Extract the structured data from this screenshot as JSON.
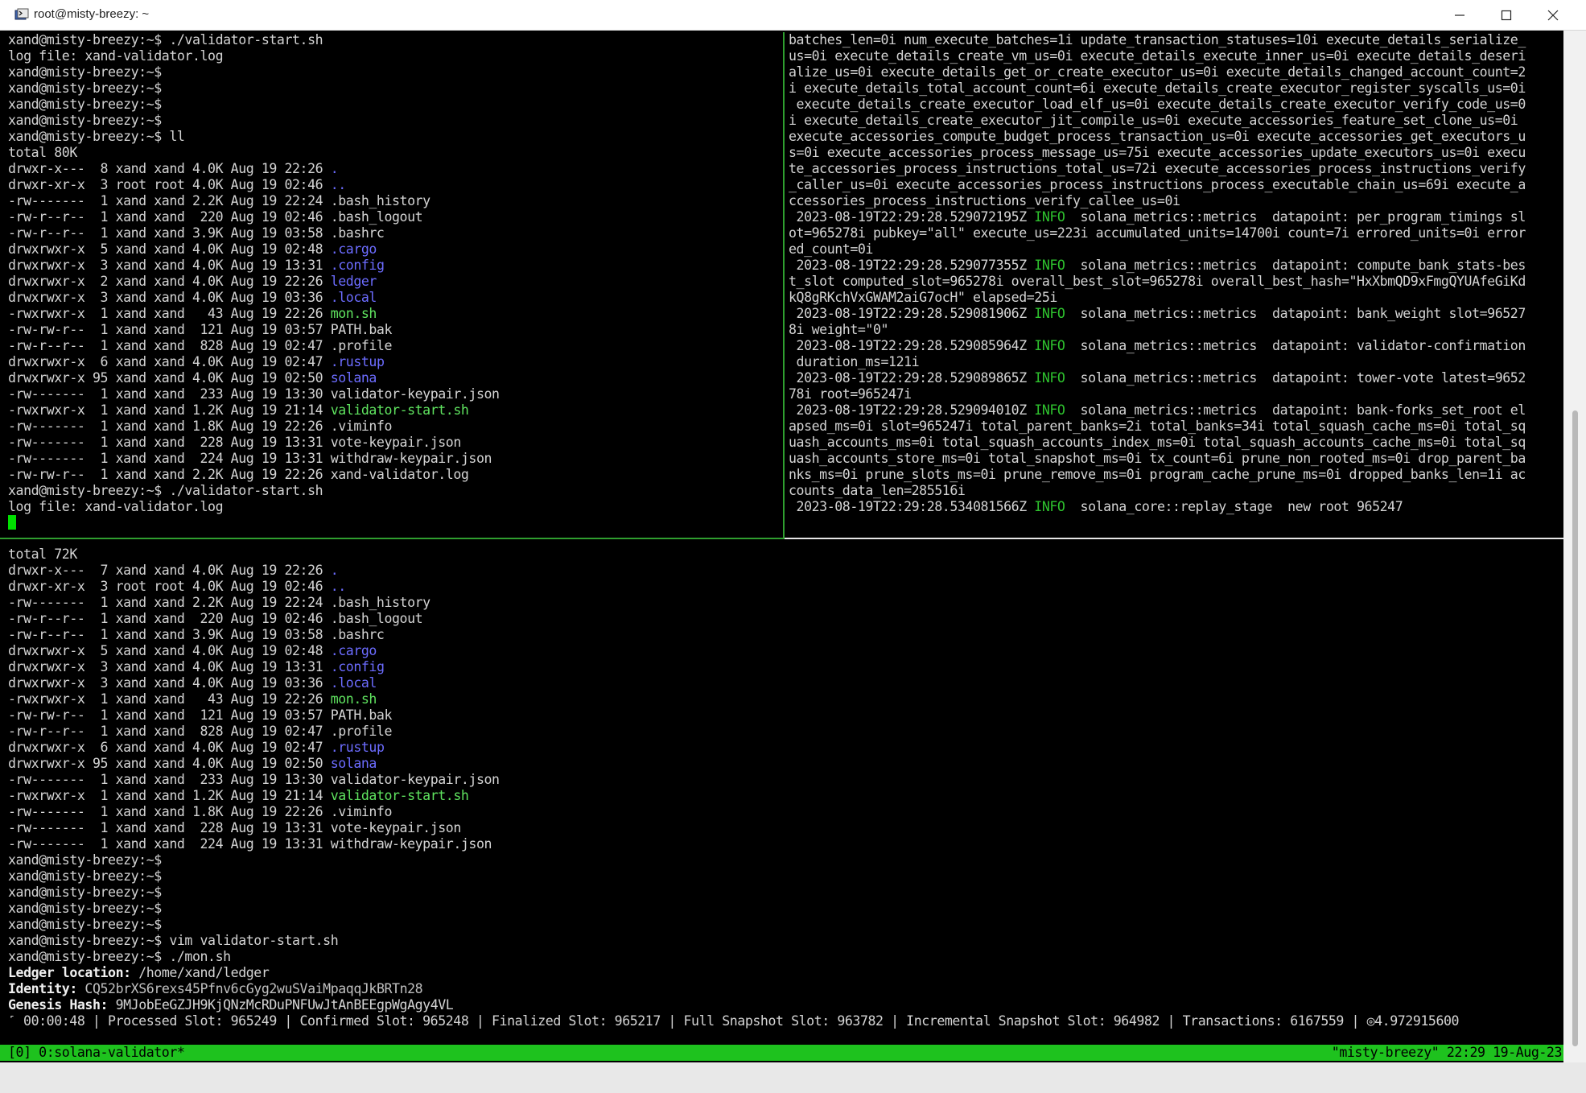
{
  "window": {
    "title": "root@misty-breezy: ~",
    "minimize_label": "–",
    "maximize_label": "□",
    "close_label": "×",
    "icon": "terminal-app-icon"
  },
  "pane_top_left": {
    "lines": [
      [
        {
          "t": "xand@misty-breezy:~$ ./validator-start.sh"
        }
      ],
      [
        {
          "t": "log file: xand-validator.log"
        }
      ],
      [
        {
          "t": "xand@misty-breezy:~$"
        }
      ],
      [
        {
          "t": "xand@misty-breezy:~$"
        }
      ],
      [
        {
          "t": "xand@misty-breezy:~$"
        }
      ],
      [
        {
          "t": "xand@misty-breezy:~$"
        }
      ],
      [
        {
          "t": "xand@misty-breezy:~$ ll"
        }
      ],
      [
        {
          "t": "total 80K"
        }
      ],
      [
        {
          "t": "drwxr-x---  8 xand xand 4.0K Aug 19 22:26 "
        },
        {
          "t": ".",
          "c": "blue"
        }
      ],
      [
        {
          "t": "drwxr-xr-x  3 root root 4.0K Aug 19 02:46 "
        },
        {
          "t": "..",
          "c": "blue"
        }
      ],
      [
        {
          "t": "-rw-------  1 xand xand 2.2K Aug 19 22:24 .bash_history"
        }
      ],
      [
        {
          "t": "-rw-r--r--  1 xand xand  220 Aug 19 02:46 .bash_logout"
        }
      ],
      [
        {
          "t": "-rw-r--r--  1 xand xand 3.9K Aug 19 03:58 .bashrc"
        }
      ],
      [
        {
          "t": "drwxrwxr-x  5 xand xand 4.0K Aug 19 02:48 "
        },
        {
          "t": ".cargo",
          "c": "blue"
        }
      ],
      [
        {
          "t": "drwxrwxr-x  3 xand xand 4.0K Aug 19 13:31 "
        },
        {
          "t": ".config",
          "c": "blue"
        }
      ],
      [
        {
          "t": "drwxrwxr-x  2 xand xand 4.0K Aug 19 22:26 "
        },
        {
          "t": "ledger",
          "c": "blue"
        }
      ],
      [
        {
          "t": "drwxrwxr-x  3 xand xand 4.0K Aug 19 03:36 "
        },
        {
          "t": ".local",
          "c": "blue"
        }
      ],
      [
        {
          "t": "-rwxrwxr-x  1 xand xand   43 Aug 19 22:26 "
        },
        {
          "t": "mon.sh",
          "c": "green"
        }
      ],
      [
        {
          "t": "-rw-rw-r--  1 xand xand  121 Aug 19 03:57 PATH.bak"
        }
      ],
      [
        {
          "t": "-rw-r--r--  1 xand xand  828 Aug 19 02:47 .profile"
        }
      ],
      [
        {
          "t": "drwxrwxr-x  6 xand xand 4.0K Aug 19 02:47 "
        },
        {
          "t": ".rustup",
          "c": "blue"
        }
      ],
      [
        {
          "t": "drwxrwxr-x 95 xand xand 4.0K Aug 19 02:50 "
        },
        {
          "t": "solana",
          "c": "blue"
        }
      ],
      [
        {
          "t": "-rw-------  1 xand xand  233 Aug 19 13:30 validator-keypair.json"
        }
      ],
      [
        {
          "t": "-rwxrwxr-x  1 xand xand 1.2K Aug 19 21:14 "
        },
        {
          "t": "validator-start.sh",
          "c": "green"
        }
      ],
      [
        {
          "t": "-rw-------  1 xand xand 1.8K Aug 19 22:26 .viminfo"
        }
      ],
      [
        {
          "t": "-rw-------  1 xand xand  228 Aug 19 13:31 vote-keypair.json"
        }
      ],
      [
        {
          "t": "-rw-------  1 xand xand  224 Aug 19 13:31 withdraw-keypair.json"
        }
      ],
      [
        {
          "t": "-rw-rw-r--  1 xand xand 2.2K Aug 19 22:26 xand-validator.log"
        }
      ],
      [
        {
          "t": "xand@misty-breezy:~$ ./validator-start.sh"
        }
      ],
      [
        {
          "t": "log file: xand-validator.log"
        }
      ]
    ]
  },
  "pane_top_right": {
    "lines": [
      [
        {
          "t": "batches_len=0i num_execute_batches=1i update_transaction_statuses=10i execute_details_serialize_"
        }
      ],
      [
        {
          "t": "us=0i execute_details_create_vm_us=0i execute_details_execute_inner_us=0i execute_details_deseri"
        }
      ],
      [
        {
          "t": "alize_us=0i execute_details_get_or_create_executor_us=0i execute_details_changed_account_count=2"
        }
      ],
      [
        {
          "t": "i execute_details_total_account_count=6i execute_details_create_executor_register_syscalls_us=0i"
        }
      ],
      [
        {
          "t": " execute_details_create_executor_load_elf_us=0i execute_details_create_executor_verify_code_us=0"
        }
      ],
      [
        {
          "t": "i execute_details_create_executor_jit_compile_us=0i execute_accessories_feature_set_clone_us=0i"
        }
      ],
      [
        {
          "t": "execute_accessories_compute_budget_process_transaction_us=0i execute_accessories_get_executors_u"
        }
      ],
      [
        {
          "t": "s=0i execute_accessories_process_message_us=75i execute_accessories_update_executors_us=0i execu"
        }
      ],
      [
        {
          "t": "te_accessories_process_instructions_total_us=72i execute_accessories_process_instructions_verify"
        }
      ],
      [
        {
          "t": "_caller_us=0i execute_accessories_process_instructions_process_executable_chain_us=69i execute_a"
        }
      ],
      [
        {
          "t": "ccessories_process_instructions_verify_callee_us=0i"
        }
      ],
      [
        {
          "t": " 2023-08-19T22:29:28.529072195Z "
        },
        {
          "t": "INFO",
          "c": "info"
        },
        {
          "t": "  solana_metrics::metrics  datapoint: per_program_timings sl"
        }
      ],
      [
        {
          "t": "ot=965278i pubkey=\"all\" execute_us=223i accumulated_units=14700i count=7i errored_units=0i error"
        }
      ],
      [
        {
          "t": "ed_count=0i"
        }
      ],
      [
        {
          "t": " 2023-08-19T22:29:28.529077355Z "
        },
        {
          "t": "INFO",
          "c": "info"
        },
        {
          "t": "  solana_metrics::metrics  datapoint: compute_bank_stats-bes"
        }
      ],
      [
        {
          "t": "t_slot computed_slot=965278i overall_best_slot=965278i overall_best_hash=\"HxXbmQD9xFmgQYUAfeGiKd"
        }
      ],
      [
        {
          "t": "kQ8gRKchVxGWAM2aiG7ocH\" elapsed=25i"
        }
      ],
      [
        {
          "t": " 2023-08-19T22:29:28.529081906Z "
        },
        {
          "t": "INFO",
          "c": "info"
        },
        {
          "t": "  solana_metrics::metrics  datapoint: bank_weight slot=96527"
        }
      ],
      [
        {
          "t": "8i weight=\"0\""
        }
      ],
      [
        {
          "t": " 2023-08-19T22:29:28.529085964Z "
        },
        {
          "t": "INFO",
          "c": "info"
        },
        {
          "t": "  solana_metrics::metrics  datapoint: validator-confirmation"
        }
      ],
      [
        {
          "t": " duration_ms=121i"
        }
      ],
      [
        {
          "t": " 2023-08-19T22:29:28.529089865Z "
        },
        {
          "t": "INFO",
          "c": "info"
        },
        {
          "t": "  solana_metrics::metrics  datapoint: tower-vote latest=9652"
        }
      ],
      [
        {
          "t": "78i root=965247i"
        }
      ],
      [
        {
          "t": " 2023-08-19T22:29:28.529094010Z "
        },
        {
          "t": "INFO",
          "c": "info"
        },
        {
          "t": "  solana_metrics::metrics  datapoint: bank-forks_set_root el"
        }
      ],
      [
        {
          "t": "apsed_ms=0i slot=965247i total_parent_banks=2i total_banks=34i total_squash_cache_ms=0i total_sq"
        }
      ],
      [
        {
          "t": "uash_accounts_ms=0i total_squash_accounts_index_ms=0i total_squash_accounts_cache_ms=0i total_sq"
        }
      ],
      [
        {
          "t": "uash_accounts_store_ms=0i total_snapshot_ms=0i tx_count=6i prune_non_rooted_ms=0i drop_parent_ba"
        }
      ],
      [
        {
          "t": "nks_ms=0i prune_slots_ms=0i prune_remove_ms=0i program_cache_prune_ms=0i dropped_banks_len=1i ac"
        }
      ],
      [
        {
          "t": "counts_data_len=285516i"
        }
      ],
      [
        {
          "t": " 2023-08-19T22:29:28.534081566Z "
        },
        {
          "t": "INFO",
          "c": "info"
        },
        {
          "t": "  solana_core::replay_stage  new root 965247"
        }
      ]
    ]
  },
  "pane_bottom": {
    "lines": [
      [
        {
          "t": "total 72K"
        }
      ],
      [
        {
          "t": "drwxr-x---  7 xand xand 4.0K Aug 19 22:26 "
        },
        {
          "t": ".",
          "c": "blue"
        }
      ],
      [
        {
          "t": "drwxr-xr-x  3 root root 4.0K Aug 19 02:46 "
        },
        {
          "t": "..",
          "c": "blue"
        }
      ],
      [
        {
          "t": "-rw-------  1 xand xand 2.2K Aug 19 22:24 .bash_history"
        }
      ],
      [
        {
          "t": "-rw-r--r--  1 xand xand  220 Aug 19 02:46 .bash_logout"
        }
      ],
      [
        {
          "t": "-rw-r--r--  1 xand xand 3.9K Aug 19 03:58 .bashrc"
        }
      ],
      [
        {
          "t": "drwxrwxr-x  5 xand xand 4.0K Aug 19 02:48 "
        },
        {
          "t": ".cargo",
          "c": "blue"
        }
      ],
      [
        {
          "t": "drwxrwxr-x  3 xand xand 4.0K Aug 19 13:31 "
        },
        {
          "t": ".config",
          "c": "blue"
        }
      ],
      [
        {
          "t": "drwxrwxr-x  3 xand xand 4.0K Aug 19 03:36 "
        },
        {
          "t": ".local",
          "c": "blue"
        }
      ],
      [
        {
          "t": "-rwxrwxr-x  1 xand xand   43 Aug 19 22:26 "
        },
        {
          "t": "mon.sh",
          "c": "green"
        }
      ],
      [
        {
          "t": "-rw-rw-r--  1 xand xand  121 Aug 19 03:57 PATH.bak"
        }
      ],
      [
        {
          "t": "-rw-r--r--  1 xand xand  828 Aug 19 02:47 .profile"
        }
      ],
      [
        {
          "t": "drwxrwxr-x  6 xand xand 4.0K Aug 19 02:47 "
        },
        {
          "t": ".rustup",
          "c": "blue"
        }
      ],
      [
        {
          "t": "drwxrwxr-x 95 xand xand 4.0K Aug 19 02:50 "
        },
        {
          "t": "solana",
          "c": "blue"
        }
      ],
      [
        {
          "t": "-rw-------  1 xand xand  233 Aug 19 13:30 validator-keypair.json"
        }
      ],
      [
        {
          "t": "-rwxrwxr-x  1 xand xand 1.2K Aug 19 21:14 "
        },
        {
          "t": "validator-start.sh",
          "c": "green"
        }
      ],
      [
        {
          "t": "-rw-------  1 xand xand 1.8K Aug 19 22:26 .viminfo"
        }
      ],
      [
        {
          "t": "-rw-------  1 xand xand  228 Aug 19 13:31 vote-keypair.json"
        }
      ],
      [
        {
          "t": "-rw-------  1 xand xand  224 Aug 19 13:31 withdraw-keypair.json"
        }
      ],
      [
        {
          "t": "xand@misty-breezy:~$"
        }
      ],
      [
        {
          "t": "xand@misty-breezy:~$"
        }
      ],
      [
        {
          "t": "xand@misty-breezy:~$"
        }
      ],
      [
        {
          "t": "xand@misty-breezy:~$"
        }
      ],
      [
        {
          "t": "xand@misty-breezy:~$"
        }
      ],
      [
        {
          "t": "xand@misty-breezy:~$ vim validator-start.sh"
        }
      ],
      [
        {
          "t": "xand@misty-breezy:~$ ./mon.sh"
        }
      ],
      [
        {
          "t": "Ledger location:",
          "c": "bold"
        },
        {
          "t": " /home/xand/ledger"
        }
      ],
      [
        {
          "t": "Identity:",
          "c": "bold"
        },
        {
          "t": " CQ52brXS6rexs45Pfnv6cGyg2wuSVaiMpaqqJkBRTn28",
          "c": "dim"
        }
      ],
      [
        {
          "t": "Genesis Hash:",
          "c": "bold"
        },
        {
          "t": " 9MJobEeGZJH9KjQNzMcRDuPNFUwJtAnBEEgpWgAgy4VL"
        }
      ],
      [
        {
          "t": "˹ 00:00:48 | Processed Slot: 965249 | Confirmed Slot: 965248 | Finalized Slot: 965217 | Full Snapshot Slot: 963782 | Incremental Snapshot Slot: 964982 | Transactions: 6167559 | ◎4.972915600"
        }
      ]
    ]
  },
  "status_bar": {
    "left": "[0] 0:solana-validator*",
    "right": "\"misty-breezy\" 22:29 19-Aug-23"
  },
  "colors": {
    "terminal_bg": "#000000",
    "text": "#d4d4d4",
    "dir_blue": "#6c6cff",
    "exec_green": "#5fe35f",
    "info_green": "#2ec22e",
    "status_bar_green": "#1ec21e",
    "pane_border": "#2f9e2f"
  }
}
